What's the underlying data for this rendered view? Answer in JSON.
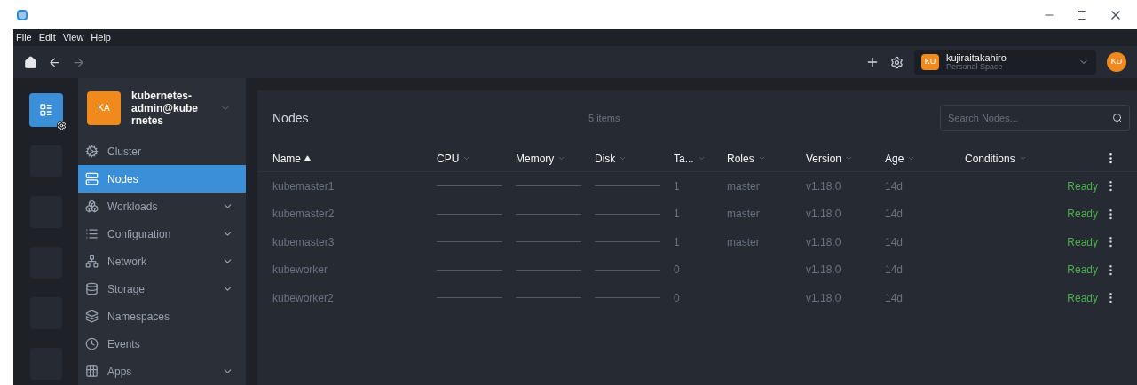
{
  "menu": [
    "File",
    "Edit",
    "View",
    "Help"
  ],
  "account": {
    "initials": "KU",
    "name": "kujiraitakahiro",
    "space": "Personal Space",
    "avatar": "KU"
  },
  "cluster": {
    "initials": "KA",
    "name": "kubernetes-admin@kubernetes"
  },
  "sidebar": {
    "items": [
      {
        "label": "Cluster",
        "selected": false,
        "expandable": false
      },
      {
        "label": "Nodes",
        "selected": true,
        "expandable": false
      },
      {
        "label": "Workloads",
        "selected": false,
        "expandable": true
      },
      {
        "label": "Configuration",
        "selected": false,
        "expandable": true
      },
      {
        "label": "Network",
        "selected": false,
        "expandable": true
      },
      {
        "label": "Storage",
        "selected": false,
        "expandable": true
      },
      {
        "label": "Namespaces",
        "selected": false,
        "expandable": false
      },
      {
        "label": "Events",
        "selected": false,
        "expandable": false
      },
      {
        "label": "Apps",
        "selected": false,
        "expandable": true
      }
    ]
  },
  "table": {
    "title": "Nodes",
    "count": "5 items",
    "search": {
      "placeholder": "Search Nodes..."
    },
    "columns": [
      {
        "label": "Name",
        "sorted": true
      },
      {
        "label": "CPU",
        "sorted": false
      },
      {
        "label": "Memory",
        "sorted": false
      },
      {
        "label": "Disk",
        "sorted": false
      },
      {
        "label": "Ta...",
        "sorted": false
      },
      {
        "label": "Roles",
        "sorted": false
      },
      {
        "label": "Version",
        "sorted": false
      },
      {
        "label": "Age",
        "sorted": false
      },
      {
        "label": "Conditions",
        "sorted": false
      }
    ],
    "rows": [
      {
        "name": "kubemaster1",
        "taints": "1",
        "roles": "master",
        "version": "v1.18.0",
        "age": "14d",
        "conditions": "Ready"
      },
      {
        "name": "kubemaster2",
        "taints": "1",
        "roles": "master",
        "version": "v1.18.0",
        "age": "14d",
        "conditions": "Ready"
      },
      {
        "name": "kubemaster3",
        "taints": "1",
        "roles": "master",
        "version": "v1.18.0",
        "age": "14d",
        "conditions": "Ready"
      },
      {
        "name": "kubeworker",
        "taints": "0",
        "version": "v1.18.0",
        "age": "14d",
        "conditions": "Ready"
      },
      {
        "name": "kubeworker2",
        "taints": "0",
        "version": "v1.18.0",
        "age": "14d",
        "conditions": "Ready"
      }
    ]
  }
}
